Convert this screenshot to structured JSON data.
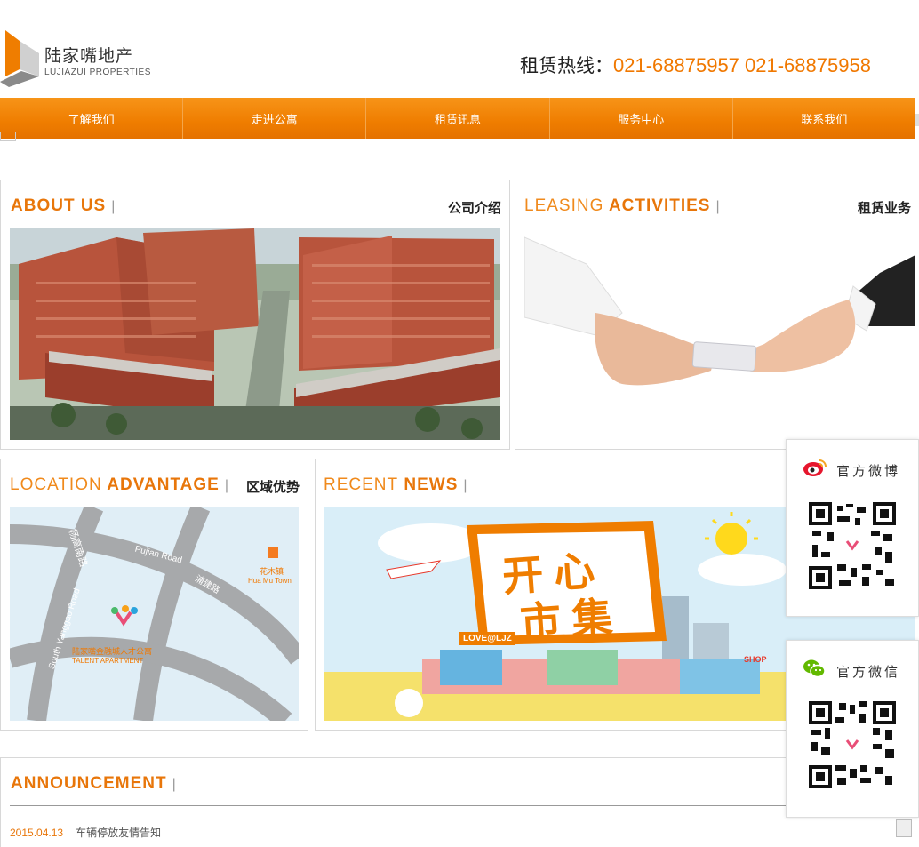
{
  "header": {
    "logo_cn": "陆家嘴地产",
    "logo_en": "LUJIAZUI PROPERTIES",
    "hotline_label": "租赁热线：",
    "hotline_numbers": "021-68875957 021-68875958"
  },
  "nav": {
    "items": [
      {
        "label": "了解我们"
      },
      {
        "label": "走进公寓"
      },
      {
        "label": "租赁讯息"
      },
      {
        "label": "服务中心"
      },
      {
        "label": "联系我们"
      }
    ]
  },
  "sections": {
    "about": {
      "title_bold": "ABOUT US",
      "separator": "|",
      "cn": "公司介绍"
    },
    "leasing": {
      "title_light": "LEASING",
      "title_bold": "ACTIVITIES",
      "separator": "|",
      "cn": "租赁业务"
    },
    "location": {
      "title_light": "LOCATION",
      "title_bold": "ADVANTAGE",
      "separator": "|",
      "cn": "区域优势"
    },
    "news": {
      "title_light": "RECENT",
      "title_bold": "NEWS",
      "separator": "|"
    },
    "announcement": {
      "title_bold": "ANNOUNCEMENT",
      "separator": "|"
    }
  },
  "map": {
    "road1": "杨高南路",
    "road2": "Pujian Road",
    "road3": "浦建路",
    "road4": "South Yanggao Road",
    "poi_cn": "花木镇",
    "poi_en": "Hua Mu Town",
    "apt_cn": "陆家嘴金融城人才公寓",
    "apt_en": "TALENT APARTMENT"
  },
  "news_banner": {
    "headline_top": "开心",
    "headline_bottom": "市集",
    "tag": "LOVE@LJZ",
    "shop": "SHOP"
  },
  "side_widget": {
    "weibo_label": "官方微博",
    "wechat_label": "官方微信"
  },
  "announcements": [
    {
      "date": "2015.04.13",
      "text": "车辆停放友情告知"
    }
  ],
  "colors": {
    "accent": "#ef7d00",
    "nav_top": "#f79418"
  }
}
